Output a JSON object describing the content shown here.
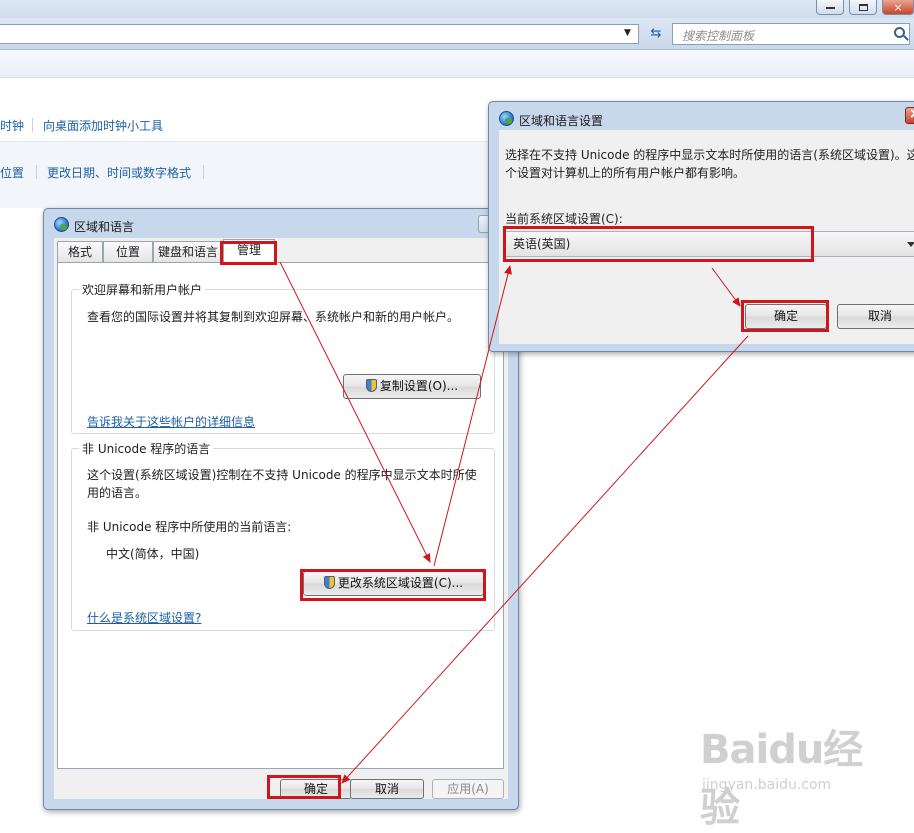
{
  "search": {
    "placeholder": "搜索控制面板"
  },
  "control_panel": {
    "row1": {
      "link_left": "时钟",
      "link_gadget": "向桌面添加时钟小工具"
    },
    "row2": {
      "link_left": "位置",
      "link_formats": "更改日期、时间或数字格式"
    }
  },
  "dialog_region": {
    "title": "区域和语言",
    "tabs": [
      "格式",
      "位置",
      "键盘和语言",
      "管理"
    ],
    "welcome_group": {
      "label": "欢迎屏幕和新用户帐户",
      "description": "查看您的国际设置并将其复制到欢迎屏幕、系统帐户和新的用户帐户。",
      "copy_button": "复制设置(O)...",
      "help_link": "告诉我关于这些帐户的详细信息"
    },
    "unicode_group": {
      "label": "非 Unicode 程序的语言",
      "description_line1": "这个设置(系统区域设置)控制在不支持 Unicode 的程序中显示文本时所使",
      "description_line2": "用的语言。",
      "current_label": "非 Unicode 程序中所使用的当前语言:",
      "current_value": "中文(简体，中国)",
      "change_button": "更改系统区域设置(C)...",
      "help_link": "什么是系统区域设置?"
    },
    "buttons": {
      "ok": "确定",
      "cancel": "取消",
      "apply": "应用(A)"
    }
  },
  "dialog_locale": {
    "title": "区域和语言设置",
    "description_line1": "选择在不支持 Unicode 的程序中显示文本时所使用的语言(系统区域设置)。这",
    "description_line2": "个设置对计算机上的所有用户帐户都有影响。",
    "current_label": "当前系统区域设置(C):",
    "current_value": "英语(英国)",
    "buttons": {
      "ok": "确定",
      "cancel": "取消"
    }
  },
  "watermark": {
    "logo": "Baidu经验",
    "url": "jingyan.baidu.com"
  },
  "colors": {
    "annotation_red": "#d0161b",
    "link_blue": "#1e5fa3",
    "titlebar": "#c7d8ec"
  }
}
